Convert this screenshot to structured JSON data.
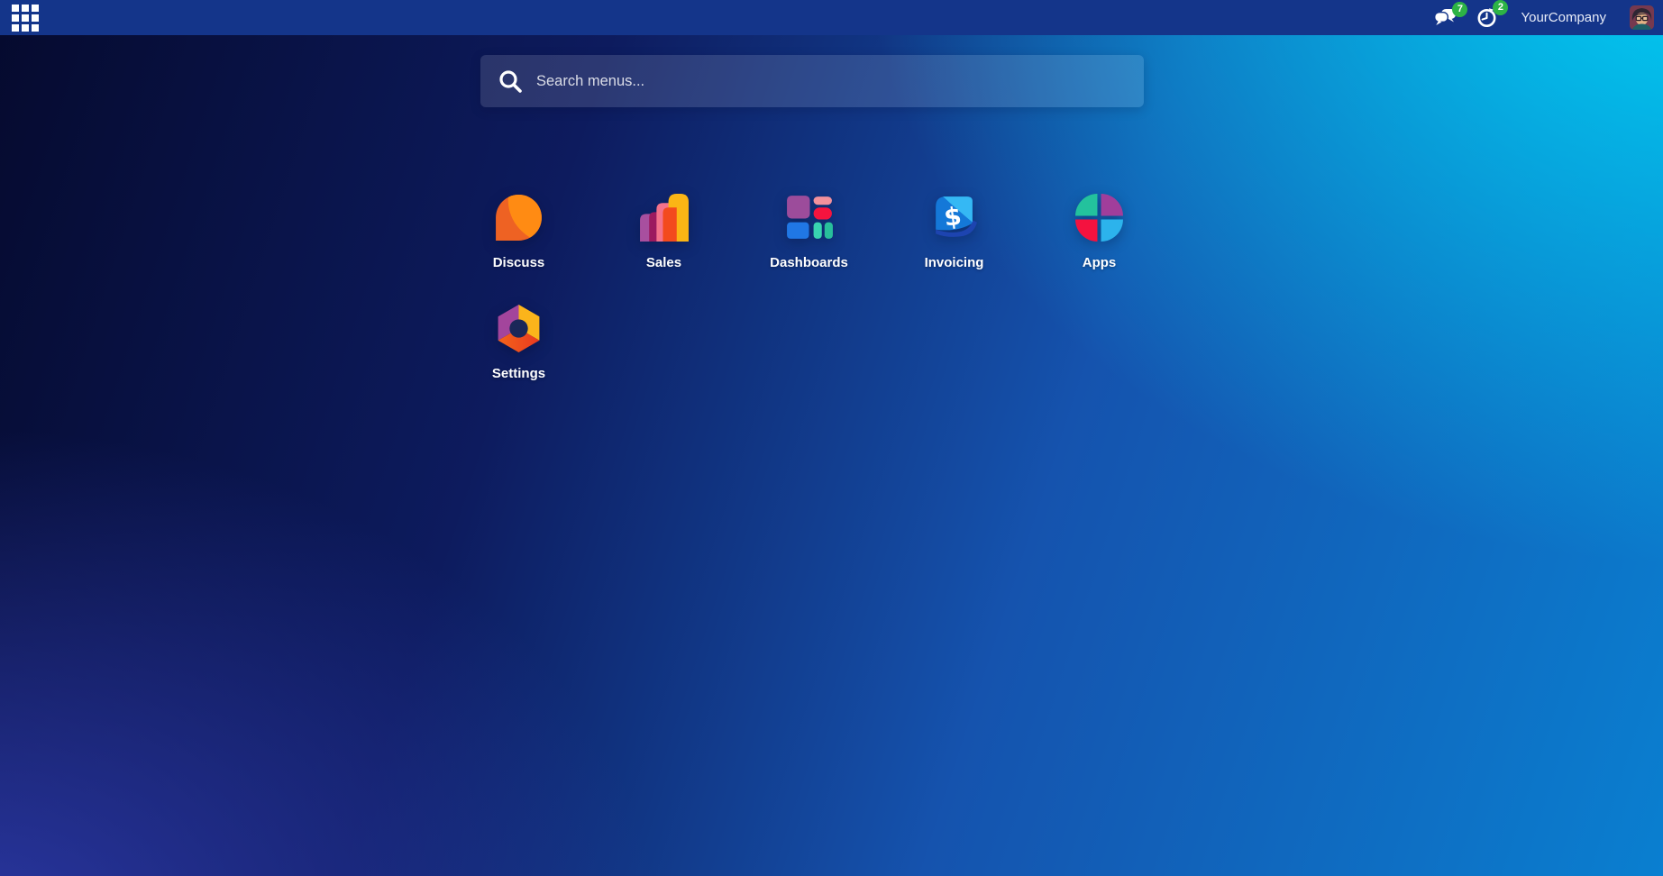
{
  "topbar": {
    "company": "YourCompany",
    "messages_badge": "7",
    "activities_badge": "2"
  },
  "search": {
    "placeholder": "Search menus..."
  },
  "apps": [
    {
      "label": "Discuss"
    },
    {
      "label": "Sales"
    },
    {
      "label": "Dashboards"
    },
    {
      "label": "Invoicing"
    },
    {
      "label": "Apps"
    },
    {
      "label": "Settings"
    }
  ],
  "icons": {
    "invoicing_dollar": "$"
  },
  "colors": {
    "topbar_bg": "#14358A",
    "badge_green": "#2DB345",
    "bg_top_left": "#050A2E",
    "bg_top_right": "#00D2F3",
    "bg_bottom_left": "#2A37A0",
    "bg_bottom_right": "#0680CB",
    "discuss_orange_dark": "#EE6223",
    "discuss_orange_light": "#FF8B13",
    "sales_palette": [
      "#A84F9F",
      "#9C1A5F",
      "#F4728B",
      "#FBB515",
      "#F34A1D"
    ],
    "dashboards_palette": [
      "#9C4C9B",
      "#F2919C",
      "#F5143E",
      "#2077E5",
      "#38D4B0",
      "#28BF9B"
    ],
    "invoicing_palette": [
      "#1478D8",
      "#35B8F4",
      "#1D44B0"
    ],
    "apps_palette": [
      "#23C29D",
      "#A13E9B",
      "#F4123F",
      "#2CB3EC"
    ],
    "settings_palette": [
      "#A3459C",
      "#FBB41B",
      "#F4641A",
      "#E93A20"
    ]
  }
}
